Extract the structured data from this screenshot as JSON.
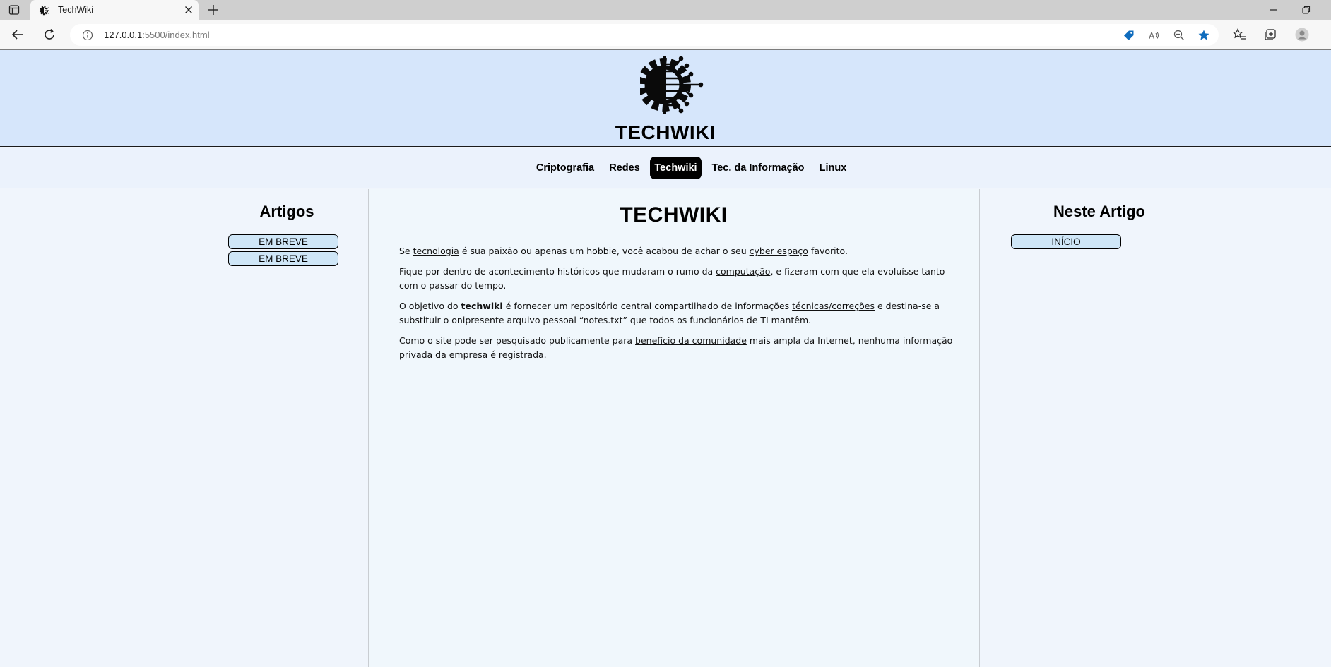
{
  "browser": {
    "tab_title": "TechWiki",
    "url_host": "127.0.0.1",
    "url_rest": ":5500/index.html"
  },
  "site": {
    "title": "TECHWIKI",
    "nav": [
      {
        "label": "Criptografia",
        "active": false
      },
      {
        "label": "Redes",
        "active": false
      },
      {
        "label": "Techwiki",
        "active": true
      },
      {
        "label": "Tec. da Informação",
        "active": false
      },
      {
        "label": "Linux",
        "active": false
      }
    ]
  },
  "left_sidebar": {
    "heading": "Artigos",
    "items": [
      "EM BREVE",
      "EM BREVE"
    ]
  },
  "right_sidebar": {
    "heading": "Neste Artigo",
    "items": [
      "INÍCIO"
    ]
  },
  "main": {
    "title": "TECHWIKI",
    "p1": {
      "t1": "Se ",
      "link1": "tecnologia",
      "t2": " é sua paixão ou apenas um hobbie, você acabou de achar o seu ",
      "link2": "cyber espaço",
      "t3": " favorito."
    },
    "p2": {
      "t1": "Fique por dentro de acontecimento históricos que mudaram o rumo da ",
      "link1": "computação",
      "t2": ", e fizeram com que ela evoluísse tanto com o passar do tempo."
    },
    "p3": {
      "t1": "O objetivo do ",
      "bold": "techwiki",
      "t2": " é fornecer um repositório central compartilhado de informações ",
      "link1": "técnicas/correções",
      "t3": " e destina-se a substituir o onipresente arquivo pessoal “notes.txt” que todos os funcionários de TI mantêm."
    },
    "p4": {
      "t1": "Como o site pode ser pesquisado publicamente para ",
      "link1": "benefício da comunidade",
      "t2": " mais ampla da Internet, nenhuma informação privada da empresa é registrada."
    }
  },
  "colors": {
    "header_bg": "#d6e6fb",
    "nav_bg": "#ebf2fc",
    "pill_bg": "#cfe6f7",
    "active_nav_bg": "#000000",
    "browser_accent": "#0f6cbd"
  }
}
